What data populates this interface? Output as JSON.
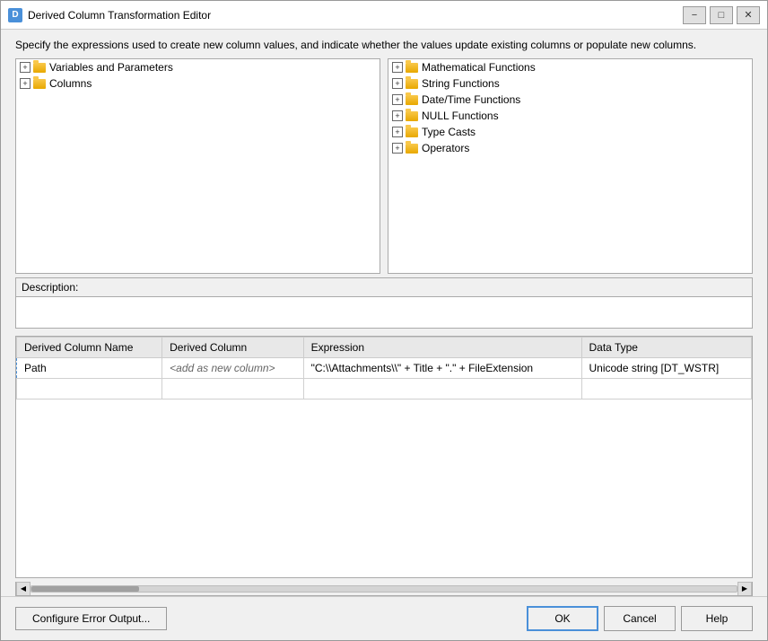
{
  "window": {
    "title": "Derived Column Transformation Editor",
    "icon_label": "D"
  },
  "description": "Specify the expressions used to create new column values, and indicate whether the values update existing columns or populate new columns.",
  "left_panel": {
    "items": [
      {
        "label": "Variables and Parameters",
        "expandable": true,
        "indent": 0
      },
      {
        "label": "Columns",
        "expandable": true,
        "indent": 0
      }
    ]
  },
  "right_panel": {
    "items": [
      {
        "label": "Mathematical Functions",
        "expandable": true
      },
      {
        "label": "String Functions",
        "expandable": true
      },
      {
        "label": "Date/Time Functions",
        "expandable": true
      },
      {
        "label": "NULL Functions",
        "expandable": true
      },
      {
        "label": "Type Casts",
        "expandable": true
      },
      {
        "label": "Operators",
        "expandable": true
      }
    ]
  },
  "description_label": "Description:",
  "description_content": "",
  "table": {
    "columns": [
      {
        "id": "derived_column_name",
        "label": "Derived Column Name"
      },
      {
        "id": "derived_column",
        "label": "Derived Column"
      },
      {
        "id": "expression",
        "label": "Expression"
      },
      {
        "id": "data_type",
        "label": "Data Type"
      }
    ],
    "rows": [
      {
        "derived_column_name": "Path",
        "derived_column": "<add as new column>",
        "expression": "\"C:\\\\Attachments\\\\\" + Title + \".\" + FileExtension",
        "data_type": "Unicode string [DT_WSTR]"
      }
    ]
  },
  "footer": {
    "configure_button": "Configure Error Output...",
    "ok_button": "OK",
    "cancel_button": "Cancel",
    "help_button": "Help"
  },
  "title_controls": {
    "minimize": "−",
    "maximize": "□",
    "close": "✕"
  }
}
